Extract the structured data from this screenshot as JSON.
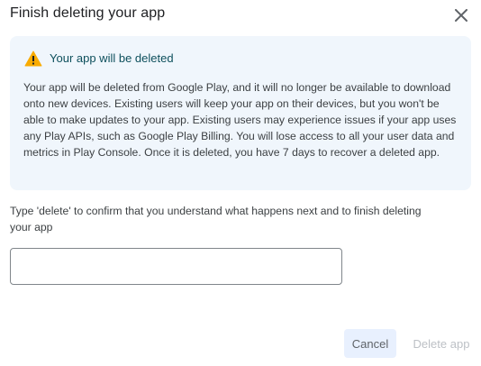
{
  "dialog": {
    "title": "Finish deleting your app",
    "close_icon": "close-icon"
  },
  "warning": {
    "icon": "warning-icon",
    "icon_color": "#f9ab00",
    "title": "Your app will be deleted",
    "body": "Your app will be deleted from Google Play, and it will no longer be available to download onto new devices. Existing users will keep your app on their devices, but you won't be able to make updates to your app. Existing users may experience issues if your app uses any Play APIs, such as Google Play Billing. You will lose access to all your user data and metrics in Play Console. Once it is deleted, you have 7 days to recover a deleted app.",
    "background": "#f0f6fc"
  },
  "confirm": {
    "prompt": "Type 'delete' to confirm that you understand what happens next and to finish deleting your app",
    "value": "",
    "placeholder": ""
  },
  "actions": {
    "cancel_label": "Cancel",
    "delete_label": "Delete app"
  }
}
